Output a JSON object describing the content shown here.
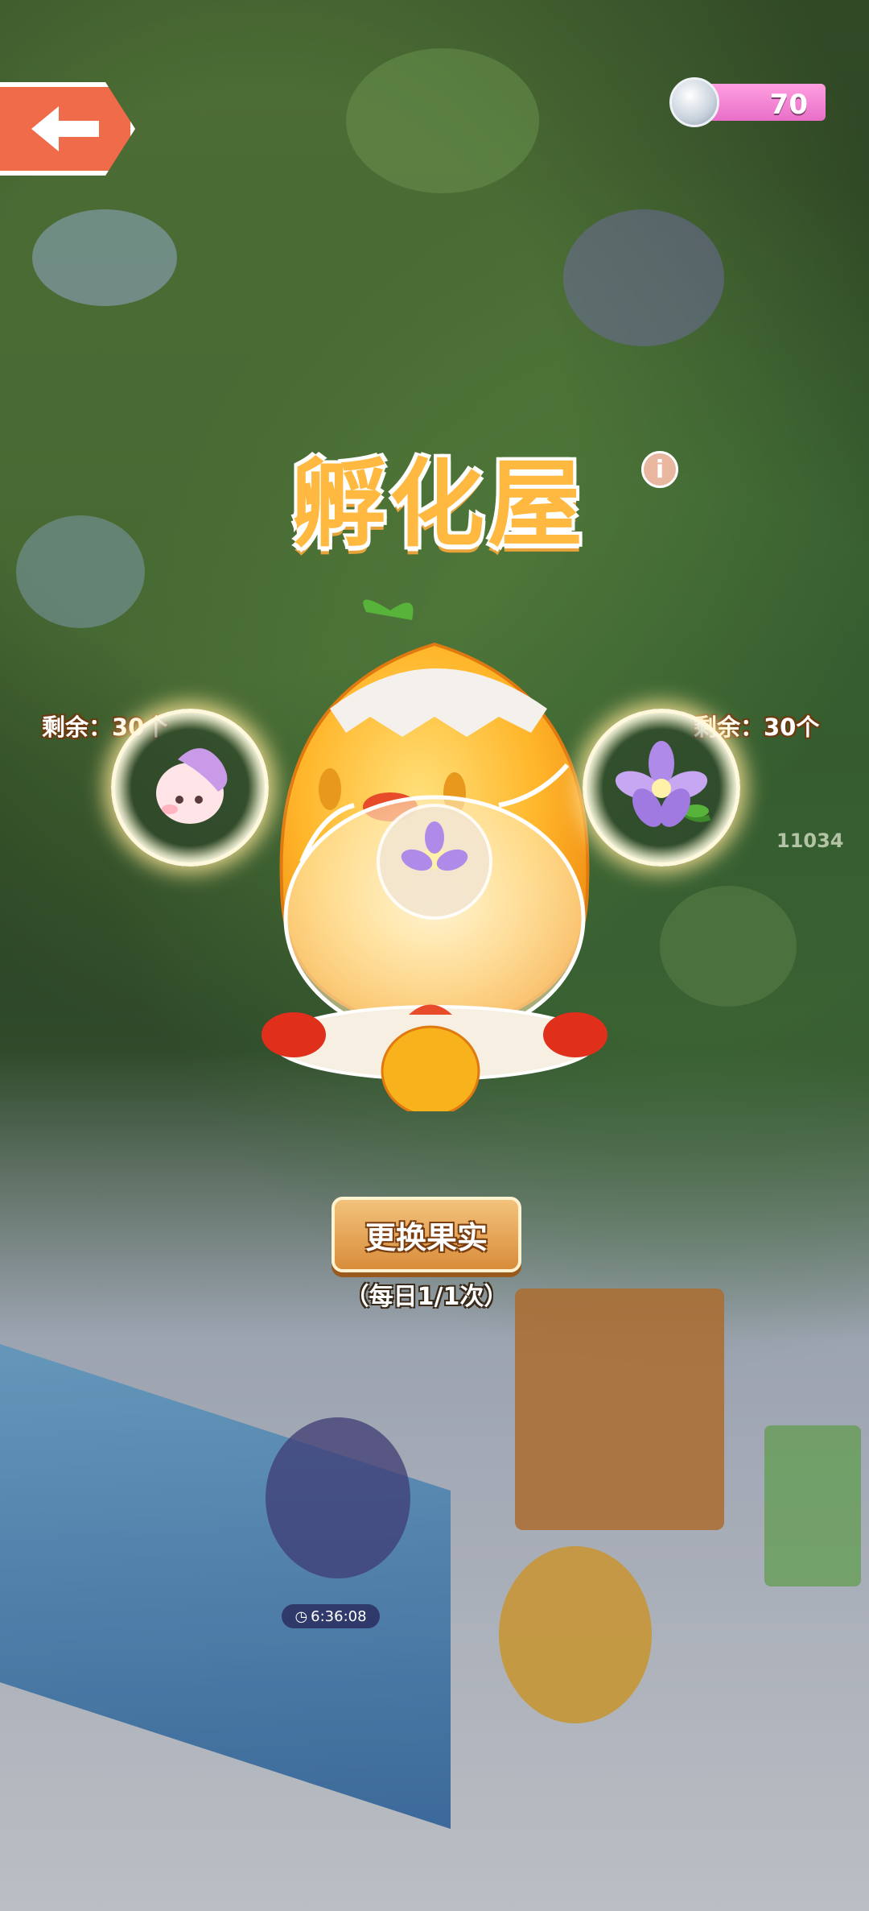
{
  "top_bar": {
    "back_icon": "arrow-left-icon",
    "currency": {
      "icon": "silver-coin-icon",
      "value": "70"
    }
  },
  "title": {
    "text": "孵化屋",
    "info_icon": "info-icon",
    "info_glyph": "i"
  },
  "incubator": {
    "left_slot": {
      "remaining": "剩余：30个",
      "item": "pink-flower-creature"
    },
    "right_slot": {
      "remaining": "剩余：30个",
      "item": "purple-flower"
    },
    "center_item": "purple-flower"
  },
  "actions": {
    "change_fruit": "更换果实",
    "daily_limit": "（每日1/1次）"
  },
  "background": {
    "timer": "6:36:08",
    "score": "11034"
  },
  "colors": {
    "accent_orange": "#ef6b4a",
    "title_yellow": "#ffb840",
    "coin_pink": "#e86fc8",
    "button_brown": "#d88d3a"
  }
}
